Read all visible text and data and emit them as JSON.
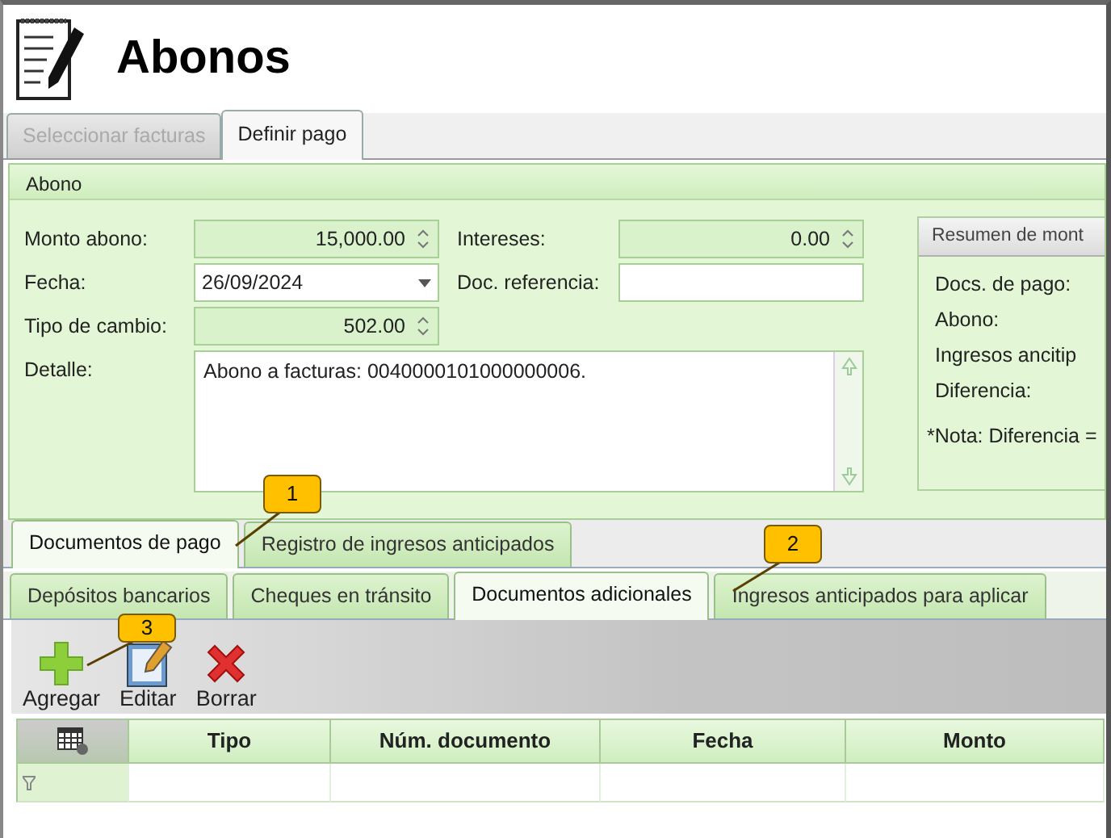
{
  "window": {
    "title": "Abonos"
  },
  "main_tabs": [
    {
      "label": "Seleccionar facturas",
      "selected": false,
      "disabled": true
    },
    {
      "label": "Definir pago",
      "selected": true,
      "disabled": false
    }
  ],
  "panel": {
    "title": "Abono",
    "fields": [
      {
        "label": "Monto abono:",
        "kind": "spin",
        "value": "15,000.00"
      },
      {
        "label": "Intereses:",
        "kind": "spin",
        "value": "0.00"
      },
      {
        "label": "Fecha:",
        "kind": "date",
        "value": "26/09/2024"
      },
      {
        "label": "Doc. referencia:",
        "kind": "text"
      },
      {
        "label": "Tipo de cambio:",
        "kind": "spin",
        "value": "502.00"
      },
      {
        "label": "Detalle:",
        "kind": "memo",
        "value": "Abono a facturas: 0040000101000000006."
      }
    ],
    "summary": {
      "title": "Resumen de mont",
      "labels": [
        "Docs. de pago:",
        "Abono:",
        "Ingresos ancitip",
        "Diferencia:"
      ],
      "note": "*Nota: Diferencia ="
    }
  },
  "outer_tabs": [
    {
      "label": "Documentos de pago",
      "selected": true
    },
    {
      "label": "Registro de ingresos anticipados",
      "selected": false
    }
  ],
  "inner_tabs": [
    {
      "label": "Depósitos bancarios",
      "selected": false
    },
    {
      "label": "Cheques en tránsito",
      "selected": false
    },
    {
      "label": "Documentos adicionales",
      "selected": true
    },
    {
      "label": "Ingresos anticipados para aplicar",
      "selected": false
    }
  ],
  "toolbar": [
    {
      "label": "Agregar",
      "kind": "add"
    },
    {
      "label": "Editar",
      "kind": "edit"
    },
    {
      "label": "Borrar",
      "kind": "delete"
    }
  ],
  "table": {
    "columns": [
      "Tipo",
      "Núm. documento",
      "Fecha",
      "Monto"
    ]
  },
  "callouts": [
    "1",
    "2",
    "3"
  ]
}
